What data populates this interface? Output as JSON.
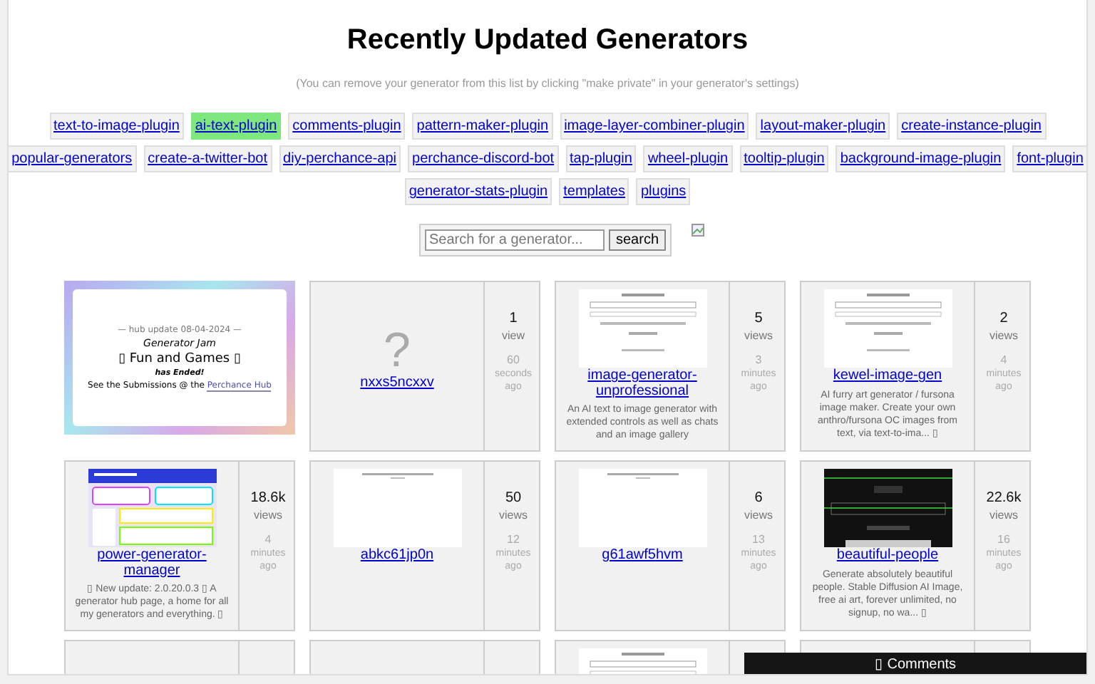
{
  "title": "Recently Updated Generators",
  "note": "(You can remove your generator from this list by clicking \"make private\" in your generator's settings)",
  "tag_rows": [
    [
      {
        "label": "text-to-image-plugin",
        "selected": false
      },
      {
        "label": "ai-text-plugin",
        "selected": true
      },
      {
        "label": "comments-plugin",
        "selected": false
      },
      {
        "label": "pattern-maker-plugin",
        "selected": false
      },
      {
        "label": "image-layer-combiner-plugin",
        "selected": false
      },
      {
        "label": "layout-maker-plugin",
        "selected": false
      },
      {
        "label": "create-instance-plugin",
        "selected": false
      }
    ],
    [
      {
        "label": "popular-generators",
        "selected": false
      },
      {
        "label": "create-a-twitter-bot",
        "selected": false
      },
      {
        "label": "diy-perchance-api",
        "selected": false
      },
      {
        "label": "perchance-discord-bot",
        "selected": false
      },
      {
        "label": "tap-plugin",
        "selected": false
      },
      {
        "label": "wheel-plugin",
        "selected": false
      },
      {
        "label": "tooltip-plugin",
        "selected": false
      },
      {
        "label": "background-image-plugin",
        "selected": false
      },
      {
        "label": "font-plugin",
        "selected": false
      }
    ],
    [
      {
        "label": "generator-stats-plugin",
        "selected": false
      },
      {
        "label": "templates",
        "selected": false
      },
      {
        "label": "plugins",
        "selected": false
      }
    ]
  ],
  "search": {
    "placeholder": "Search for a generator...",
    "button": "search"
  },
  "cards": [
    {
      "kind": "banner",
      "kicker": "— hub update 08-04-2024 —",
      "event": "Generator Jam",
      "headline": "▯ Fun and Games ▯",
      "status": "has Ended!",
      "cta": "See the Submissions @ the ",
      "link": "Perchance Hub"
    },
    {
      "kind": "generator",
      "thumbnail": {
        "kind": "missing",
        "glyph": "?"
      },
      "name": "nxxs5ncxxv",
      "views": "1",
      "views_label": "view",
      "time": "60",
      "time_unit": "seconds",
      "time_suffix": "ago"
    },
    {
      "kind": "generator",
      "thumbnail": {
        "kind": "page"
      },
      "name": "image-generator-unprofessional",
      "description": "An AI text to image generator with extended controls as well as chats and an image gallery",
      "views": "5",
      "views_label": "views",
      "time": "3",
      "time_unit": "minutes",
      "time_suffix": "ago"
    },
    {
      "kind": "generator",
      "thumbnail": {
        "kind": "page"
      },
      "name": "kewel-image-gen",
      "description": "AI furry art generator / fursona image maker. Create your own anthro/fursona OC images from text, via text-to-ima... ▯",
      "views": "2",
      "views_label": "views",
      "time": "4",
      "time_unit": "minutes",
      "time_suffix": "ago"
    },
    {
      "kind": "generator",
      "thumbnail": {
        "kind": "colorful"
      },
      "name": "power-generator-manager",
      "description": "▯ New update: 2.0.20.0.3 ▯ A generator hub page, a home for all my generators and everything. ▯",
      "views": "18.6k",
      "views_label": "views",
      "time": "4",
      "time_unit": "minutes",
      "time_suffix": "ago"
    },
    {
      "kind": "generator",
      "thumbnail": {
        "kind": "blank"
      },
      "name": "abkc61jp0n",
      "views": "50",
      "views_label": "views",
      "time": "12",
      "time_unit": "minutes",
      "time_suffix": "ago"
    },
    {
      "kind": "generator",
      "thumbnail": {
        "kind": "blank"
      },
      "name": "g61awf5hvm",
      "views": "6",
      "views_label": "views",
      "time": "13",
      "time_unit": "minutes",
      "time_suffix": "ago"
    },
    {
      "kind": "generator",
      "thumbnail": {
        "kind": "dark"
      },
      "name": "beautiful-people",
      "description": "Generate absolutely beautiful people. Stable Diffusion AI Image, free ai art, forever unlimited, no signup, no wa... ▯",
      "views": "22.6k",
      "views_label": "views",
      "time": "16",
      "time_unit": "minutes",
      "time_suffix": "ago"
    },
    {
      "kind": "cut"
    },
    {
      "kind": "cut"
    },
    {
      "kind": "cut",
      "thumbnail": {
        "kind": "page"
      }
    },
    {
      "kind": "cut"
    }
  ],
  "comments_button": "▯ Comments"
}
